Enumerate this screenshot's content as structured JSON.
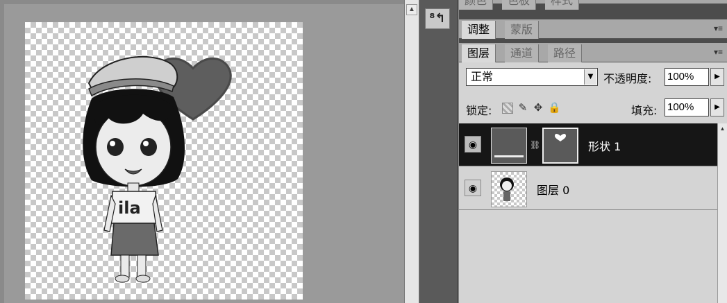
{
  "canvas": {
    "shirt_text": "ila"
  },
  "icon_strip": {
    "history_icon": "history-icon"
  },
  "panels": {
    "top_tabs": [
      "颜色",
      "色板",
      "样式"
    ],
    "adjust_tabs": [
      "调整",
      "蒙版"
    ],
    "layers_tabs": [
      "图层",
      "通道",
      "路径"
    ]
  },
  "layers_panel": {
    "blend_mode": "正常",
    "opacity_label": "不透明度:",
    "opacity_value": "100%",
    "lock_label": "锁定:",
    "fill_label": "填充:",
    "fill_value": "100%",
    "layers": [
      {
        "name": "形状 1",
        "selected": true,
        "visible": true
      },
      {
        "name": "图层 0",
        "selected": false,
        "visible": true
      }
    ]
  },
  "colors": {
    "selected_layer_bg": "#161616",
    "panel_bg": "#d4d4d4",
    "shape_fill": "#5a5a5a"
  }
}
